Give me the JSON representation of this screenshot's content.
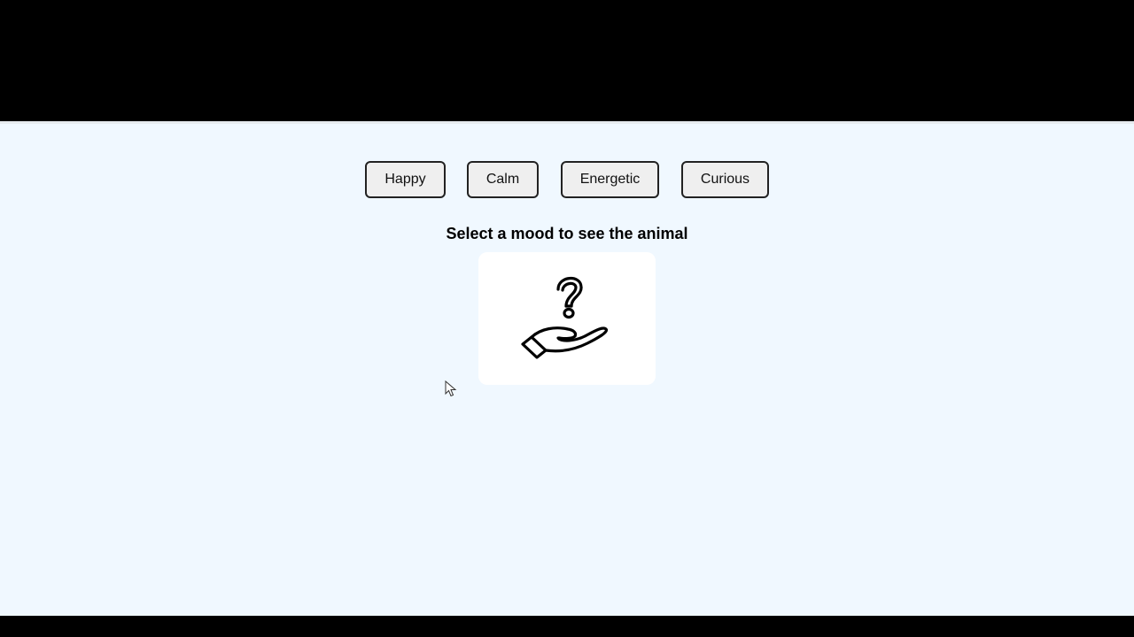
{
  "moods": {
    "happy": "Happy",
    "calm": "Calm",
    "energetic": "Energetic",
    "curious": "Curious"
  },
  "prompt": "Select a mood to see the animal",
  "animal_display": {
    "icon": "question-hand-icon"
  }
}
